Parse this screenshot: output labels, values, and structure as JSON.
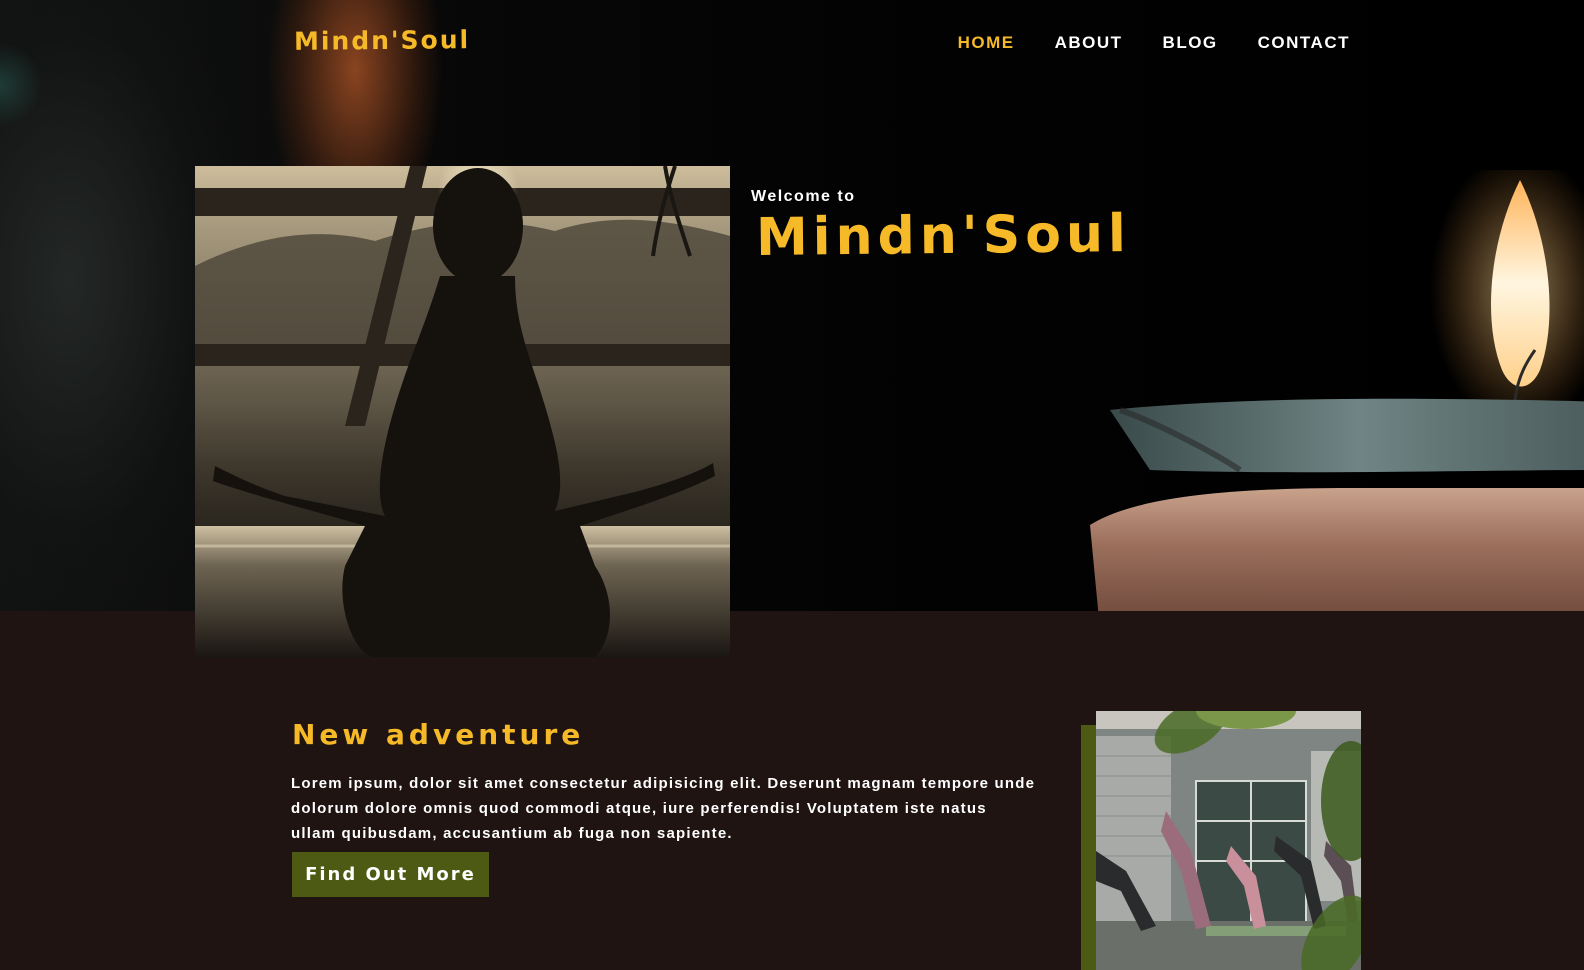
{
  "brand": {
    "logo": "Mindn'Soul",
    "accent_color": "#f6b928",
    "button_color": "#4c5a14",
    "section_background": "#201412"
  },
  "nav": {
    "items": [
      {
        "label": "HOME",
        "active": true
      },
      {
        "label": "ABOUT",
        "active": false
      },
      {
        "label": "BLOG",
        "active": false
      },
      {
        "label": "CONTACT",
        "active": false
      }
    ]
  },
  "hero": {
    "welcome_small": "Welcome to",
    "welcome_title": "Mindn'Soul",
    "image_icon": "meditation-photo",
    "background_icon": "candle-photo"
  },
  "content": {
    "title": "New adventure",
    "body": "Lorem ipsum, dolor sit amet consectetur adipisicing elit. Deserunt magnam tempore unde dolorum dolore omnis quod commodi atque, iure perferendis! Voluptatem iste natus ullam quibusdam, accusantium ab fuga non sapiente.",
    "button_label": "Find Out More",
    "image_icon": "yoga-class-photo"
  }
}
